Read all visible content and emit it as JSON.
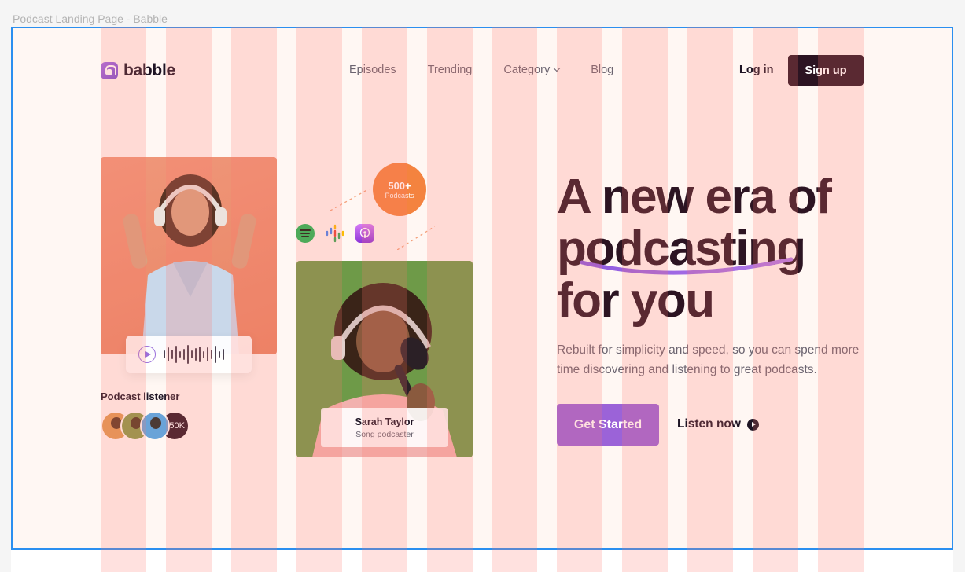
{
  "canvas": {
    "label": "Podcast Landing Page - Babble"
  },
  "brand": {
    "name": "babble",
    "accent": "#9b63d8",
    "dark": "#2c1422",
    "orange": "#f4833f"
  },
  "nav": {
    "items": [
      "Episodes",
      "Trending",
      "Category",
      "Blog"
    ],
    "login": "Log in",
    "signup": "Sign up"
  },
  "stats": {
    "podcasts_count": "500+",
    "podcasts_label": "Podcasts"
  },
  "platforms": [
    "spotify-icon",
    "google-podcasts-icon",
    "apple-podcasts-icon"
  ],
  "listeners": {
    "label": "Podcast listener",
    "count": "+50K"
  },
  "featured": {
    "name": "Sarah Taylor",
    "role": "Song podcaster"
  },
  "hero": {
    "line1": "A new era of",
    "line2": "podcasting",
    "line3": "for you",
    "subtitle": "Rebuilt for simplicity and speed, so you can spend more time discovering and listening to great podcasts.",
    "cta": "Get Started",
    "secondary": "Listen now"
  }
}
